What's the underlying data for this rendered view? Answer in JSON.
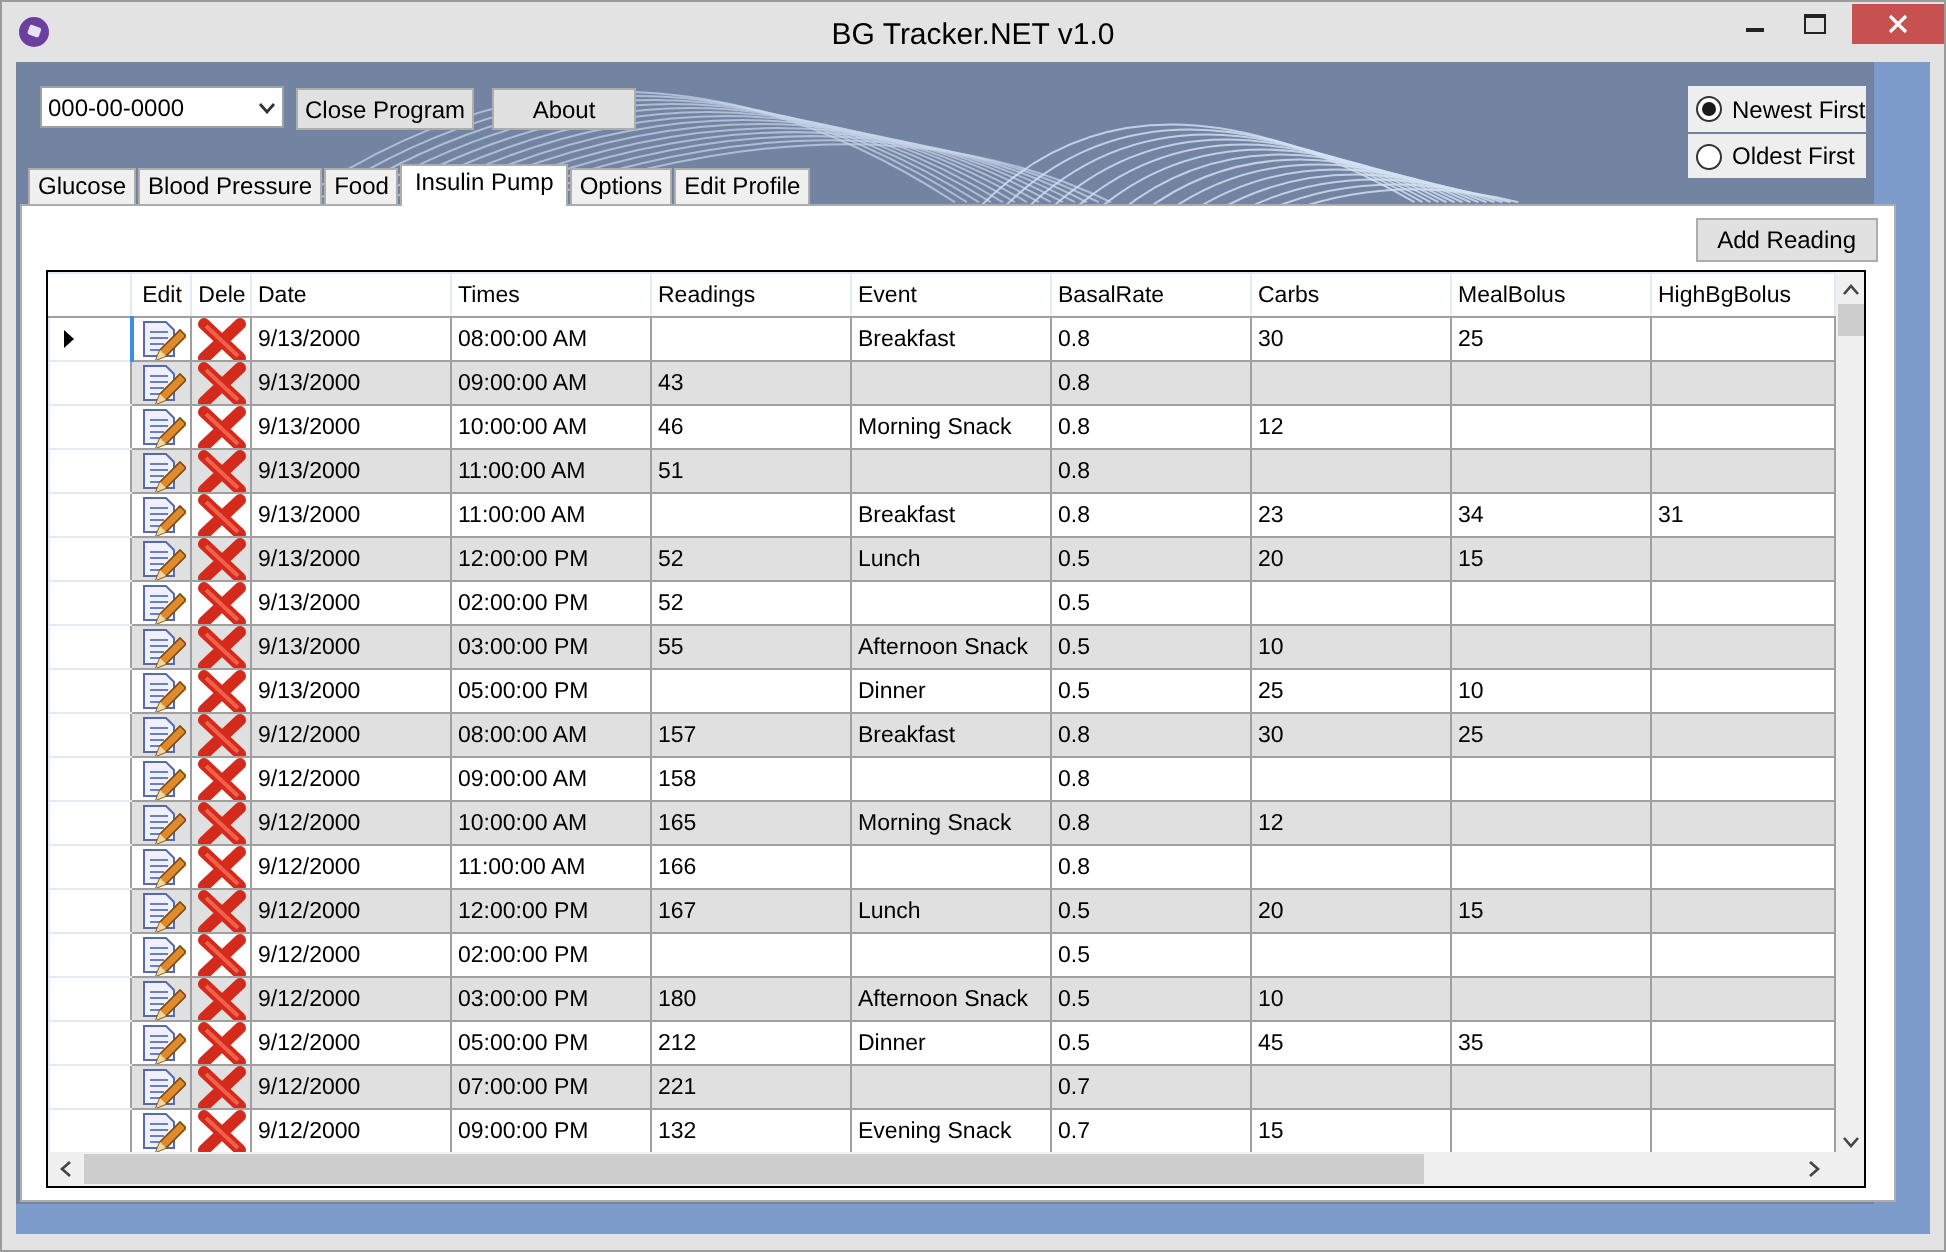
{
  "window": {
    "title": "BG Tracker.NET v1.0"
  },
  "toolbar": {
    "patient_select": {
      "value": "000-00-0000"
    },
    "buttons": [
      "Close Program",
      "About"
    ]
  },
  "sort_order": [
    {
      "label": "Newest First",
      "selected": true
    },
    {
      "label": "Oldest First",
      "selected": false
    }
  ],
  "tabs": [
    {
      "label": "Glucose",
      "selected": false
    },
    {
      "label": "Blood Pressure",
      "selected": false
    },
    {
      "label": "Food",
      "selected": false
    },
    {
      "label": "Insulin Pump",
      "selected": true
    },
    {
      "label": "Options",
      "selected": false
    },
    {
      "label": "Edit Profile",
      "selected": false
    }
  ],
  "add_button": "Add Reading",
  "grid": {
    "action_columns": [
      {
        "label": "Edit",
        "kind": "edit"
      },
      {
        "label": "Dele",
        "kind": "delete"
      }
    ],
    "columns": [
      {
        "label": "Date",
        "kind": "text"
      },
      {
        "label": "Times",
        "kind": "text"
      },
      {
        "label": "Readings",
        "kind": "text"
      },
      {
        "label": "Event",
        "kind": "text"
      },
      {
        "label": "BasalRate",
        "kind": "text"
      },
      {
        "label": "Carbs",
        "kind": "text"
      },
      {
        "label": "MealBolus",
        "kind": "text"
      },
      {
        "label": "HighBgBolus",
        "kind": "text"
      }
    ],
    "rows": [
      {
        "current": true,
        "cells": [
          "9/13/2000",
          "08:00:00 AM",
          null,
          "Breakfast",
          "0.8",
          "30",
          "25",
          null
        ]
      },
      {
        "current": false,
        "cells": [
          "9/13/2000",
          "09:00:00 AM",
          "43",
          null,
          "0.8",
          null,
          null,
          null
        ]
      },
      {
        "current": false,
        "cells": [
          "9/13/2000",
          "10:00:00 AM",
          "46",
          "Morning Snack",
          "0.8",
          "12",
          null,
          null
        ]
      },
      {
        "current": false,
        "cells": [
          "9/13/2000",
          "11:00:00 AM",
          "51",
          null,
          "0.8",
          null,
          null,
          null
        ]
      },
      {
        "current": false,
        "cells": [
          "9/13/2000",
          "11:00:00 AM",
          null,
          "Breakfast",
          "0.8",
          "23",
          "34",
          "31"
        ]
      },
      {
        "current": false,
        "cells": [
          "9/13/2000",
          "12:00:00 PM",
          "52",
          "Lunch",
          "0.5",
          "20",
          "15",
          null
        ]
      },
      {
        "current": false,
        "cells": [
          "9/13/2000",
          "02:00:00 PM",
          "52",
          null,
          "0.5",
          null,
          null,
          null
        ]
      },
      {
        "current": false,
        "cells": [
          "9/13/2000",
          "03:00:00 PM",
          "55",
          "Afternoon Snack",
          "0.5",
          "10",
          null,
          null
        ]
      },
      {
        "current": false,
        "cells": [
          "9/13/2000",
          "05:00:00 PM",
          null,
          "Dinner",
          "0.5",
          "25",
          "10",
          null
        ]
      },
      {
        "current": false,
        "cells": [
          "9/12/2000",
          "08:00:00 AM",
          "157",
          "Breakfast",
          "0.8",
          "30",
          "25",
          null
        ]
      },
      {
        "current": false,
        "cells": [
          "9/12/2000",
          "09:00:00 AM",
          "158",
          null,
          "0.8",
          null,
          null,
          null
        ]
      },
      {
        "current": false,
        "cells": [
          "9/12/2000",
          "10:00:00 AM",
          "165",
          "Morning Snack",
          "0.8",
          "12",
          null,
          null
        ]
      },
      {
        "current": false,
        "cells": [
          "9/12/2000",
          "11:00:00 AM",
          "166",
          null,
          "0.8",
          null,
          null,
          null
        ]
      },
      {
        "current": false,
        "cells": [
          "9/12/2000",
          "12:00:00 PM",
          "167",
          "Lunch",
          "0.5",
          "20",
          "15",
          null
        ]
      },
      {
        "current": false,
        "cells": [
          "9/12/2000",
          "02:00:00 PM",
          null,
          null,
          "0.5",
          null,
          null,
          null
        ]
      },
      {
        "current": false,
        "cells": [
          "9/12/2000",
          "03:00:00 PM",
          "180",
          "Afternoon Snack",
          "0.5",
          "10",
          null,
          null
        ]
      },
      {
        "current": false,
        "cells": [
          "9/12/2000",
          "05:00:00 PM",
          "212",
          "Dinner",
          "0.5",
          "45",
          "35",
          null
        ]
      },
      {
        "current": false,
        "cells": [
          "9/12/2000",
          "07:00:00 PM",
          "221",
          null,
          "0.7",
          null,
          null,
          null
        ]
      },
      {
        "current": false,
        "cells": [
          "9/12/2000",
          "09:00:00 PM",
          "132",
          "Evening Snack",
          "0.7",
          "15",
          null,
          null
        ]
      }
    ]
  }
}
